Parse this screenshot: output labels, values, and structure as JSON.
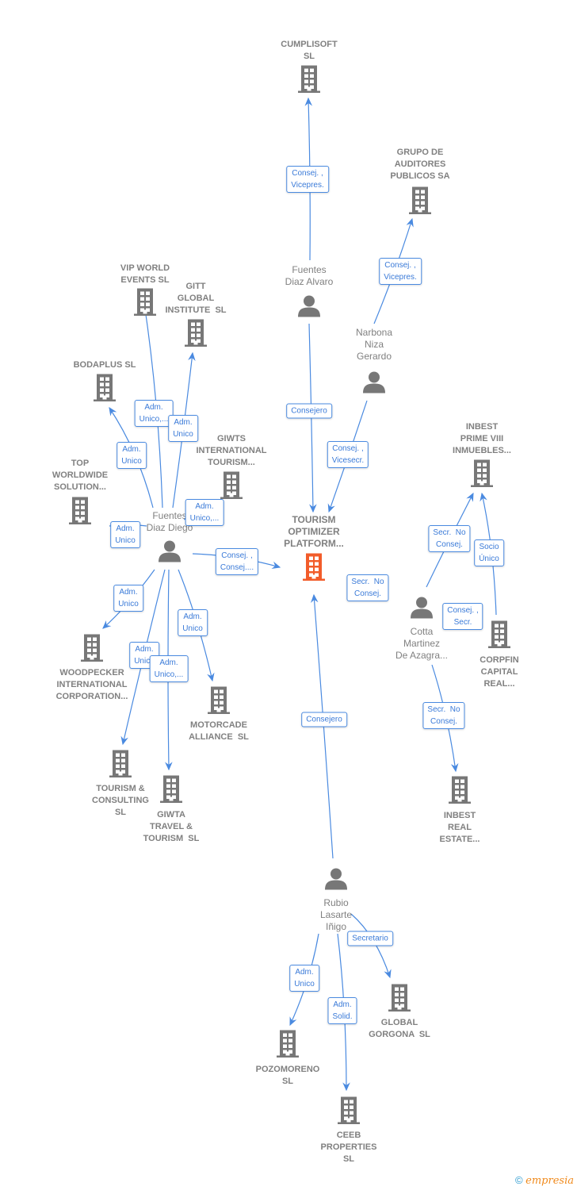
{
  "colors": {
    "edge": "#4a8ae0",
    "node": "#777777",
    "focus": "#f25c2a",
    "label": "#808080"
  },
  "nodes": [
    {
      "id": "center",
      "type": "company",
      "focus": true,
      "name": "TOURISM\nOPTIMIZER\nPLATFORM..."
    },
    {
      "id": "cumplisoft",
      "type": "company",
      "name": "CUMPLISOFT\nSL"
    },
    {
      "id": "grupo",
      "type": "company",
      "name": "GRUPO DE\nAUDITORES\nPUBLICOS SA"
    },
    {
      "id": "alvaro",
      "type": "person",
      "name": "Fuentes\nDiaz Alvaro"
    },
    {
      "id": "narbona",
      "type": "person",
      "name": "Narbona\nNiza\nGerardo"
    },
    {
      "id": "vip",
      "type": "company",
      "name": "VIP WORLD\nEVENTS SL"
    },
    {
      "id": "gitt",
      "type": "company",
      "name": "GITT\nGLOBAL\nINSTITUTE  SL"
    },
    {
      "id": "bodaplus",
      "type": "company",
      "name": "BODAPLUS SL"
    },
    {
      "id": "top",
      "type": "company",
      "name": "TOP\nWORLDWIDE\nSOLUTION..."
    },
    {
      "id": "giwts",
      "type": "company",
      "name": "GIWTS\nINTERNATIONAL\nTOURISM..."
    },
    {
      "id": "diego",
      "type": "person",
      "name": "Fuentes\nDiaz Diego"
    },
    {
      "id": "woodpecker",
      "type": "company",
      "name": "WOODPECKER\nINTERNATIONAL\nCORPORATION..."
    },
    {
      "id": "motorcade",
      "type": "company",
      "name": "MOTORCADE\nALLIANCE  SL"
    },
    {
      "id": "tourismc",
      "type": "company",
      "name": "TOURISM &\nCONSULTING\nSL"
    },
    {
      "id": "giwta",
      "type": "company",
      "name": "GIWTA\nTRAVEL &\nTOURISM  SL"
    },
    {
      "id": "inbestprime",
      "type": "company",
      "name": "INBEST\nPRIME VIII\nINMUEBLES..."
    },
    {
      "id": "cotta",
      "type": "person",
      "name": "Cotta\nMartinez\nDe Azagra..."
    },
    {
      "id": "corpfin",
      "type": "company",
      "name": "CORPFIN\nCAPITAL\nREAL..."
    },
    {
      "id": "inbestreal",
      "type": "company",
      "name": "INBEST\nREAL\nESTATE..."
    },
    {
      "id": "rubio",
      "type": "person",
      "name": "Rubio\nLasarte\nIñigo"
    },
    {
      "id": "gorgona",
      "type": "company",
      "name": "GLOBAL\nGORGONA  SL"
    },
    {
      "id": "pozomoreno",
      "type": "company",
      "name": "POZOMORENO\nSL"
    },
    {
      "id": "ceeb",
      "type": "company",
      "name": "CEEB\nPROPERTIES\nSL"
    }
  ],
  "edges": [
    {
      "from": "alvaro",
      "to": "cumplisoft",
      "label": "Consej. ,\nVicepres."
    },
    {
      "from": "narbona",
      "to": "grupo",
      "label": "Consej. ,\nVicepres."
    },
    {
      "from": "alvaro",
      "to": "center",
      "label": "Consejero"
    },
    {
      "from": "narbona",
      "to": "center",
      "label": "Consej. ,\nVicesecr."
    },
    {
      "from": "diego",
      "to": "center",
      "label": "Consej. ,\nConsej...."
    },
    {
      "from": "diego",
      "to": "vip",
      "label": "Adm.\nUnico,..."
    },
    {
      "from": "diego",
      "to": "gitt",
      "label": "Adm.\nUnico"
    },
    {
      "from": "diego",
      "to": "bodaplus",
      "label": "Adm.\nUnico"
    },
    {
      "from": "diego",
      "to": "top",
      "label": "Adm.\nUnico"
    },
    {
      "from": "diego",
      "to": "giwts",
      "label": "Adm.\nUnico,..."
    },
    {
      "from": "diego",
      "to": "woodpecker",
      "label": "Adm.\nUnico"
    },
    {
      "from": "diego",
      "to": "motorcade",
      "label": "Adm.\nUnico"
    },
    {
      "from": "diego",
      "to": "tourismc",
      "label": "Adm.\nUnico"
    },
    {
      "from": "diego",
      "to": "giwta",
      "label": "Adm.\nUnico,..."
    },
    {
      "from": "rubio",
      "to": "center",
      "label": "Consejero"
    },
    {
      "from": "cotta",
      "to": "center",
      "label": "Secr.  No\nConsej."
    },
    {
      "from": "cotta",
      "to": "inbestprime",
      "label": "Secr.  No\nConsej."
    },
    {
      "from": "corpfin",
      "to": "inbestprime",
      "label": "Socio\nÚnico"
    },
    {
      "from": "cotta",
      "to": "corpfin",
      "label": "Consej. ,\nSecr."
    },
    {
      "from": "cotta",
      "to": "inbestreal",
      "label": "Secr.  No\nConsej."
    },
    {
      "from": "rubio",
      "to": "gorgona",
      "label": "Secretario"
    },
    {
      "from": "rubio",
      "to": "pozomoreno",
      "label": "Adm.\nUnico"
    },
    {
      "from": "rubio",
      "to": "ceeb",
      "label": "Adm.\nSolid."
    }
  ],
  "footer": {
    "copyright": "©",
    "brand": "empresia"
  }
}
